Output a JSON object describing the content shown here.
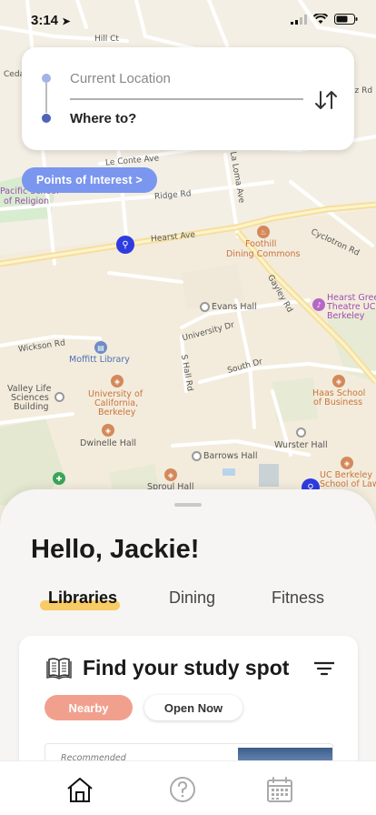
{
  "status_bar": {
    "time": "3:14"
  },
  "route": {
    "from_placeholder": "Current Location",
    "to_placeholder": "Where to?"
  },
  "poi_button": {
    "label": "Points of Interest  >"
  },
  "map": {
    "streets": {
      "hearst": "Hearst Ave",
      "ridge": "Ridge Rd",
      "le_conte": "Le Conte Ave",
      "la_loma": "La Loma Ave",
      "gayley": "Gayley Rd",
      "cyclotron": "Cyclotron Rd",
      "university": "University Dr",
      "south": "South Dr",
      "wickson": "Wickson Rd",
      "s_hall": "S Hall Rd",
      "hilltop": "Hill Ct"
    },
    "places": {
      "pacific": "Pacific School",
      "religion": "of Religion",
      "foothill_1": "Foothill",
      "foothill_2": "Dining Commons",
      "evans": "Evans Hall",
      "hearst_greek_1": "Hearst Gree",
      "hearst_greek_2": "Theatre UC",
      "hearst_greek_3": "Berkeley",
      "moffitt": "Moffitt Library",
      "valley_1": "Valley Life",
      "valley_2": "Sciences",
      "valley_3": "Building",
      "ucb_1": "University of",
      "ucb_2": "California,",
      "ucb_3": "Berkeley",
      "haas_1": "Haas School",
      "haas_2": "of Business",
      "dwinelle": "Dwinelle Hall",
      "wurster": "Wurster Hall",
      "barrows": "Barrows Hall",
      "sproul": "Sproul Hall",
      "law_1": "UC Berkeley",
      "law_2": "School of Law",
      "cedar": "Ceda",
      "rez": "ez Rd"
    }
  },
  "sheet": {
    "greeting": "Hello, Jackie!",
    "tabs": [
      "Libraries",
      "Dining",
      "Fitness"
    ],
    "study_title": "Find your study spot",
    "chips": {
      "nearby": "Nearby",
      "open_now": "Open Now"
    },
    "place_tag": "Recommended"
  },
  "nav": {
    "home": "home-icon",
    "help": "help-icon",
    "calendar": "calendar-icon"
  },
  "colors": {
    "route_top_dot": "#a3b3e6",
    "route_bottom_dot": "#4f64b8",
    "poi_pill": "#7b96ef",
    "tab_underline": "#f7cc66",
    "chip_nearby": "#f2a08e"
  }
}
